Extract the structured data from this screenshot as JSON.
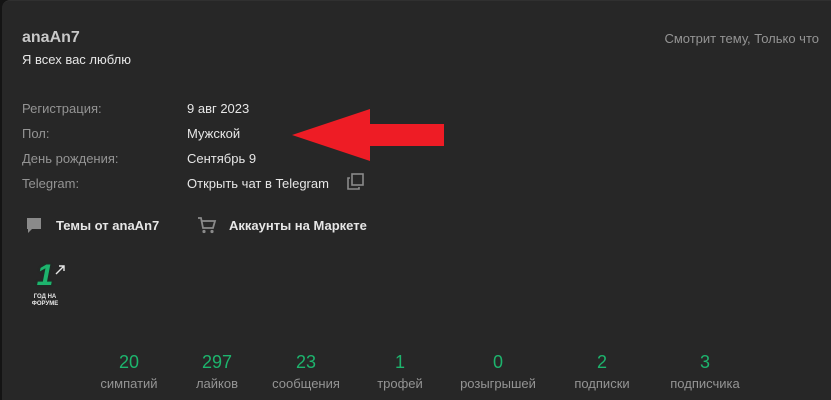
{
  "profile": {
    "username": "anaAn7",
    "status": "Я всех вас люблю",
    "activity": "Смотрит тему, Только что"
  },
  "info": {
    "registration_label": "Регистрация:",
    "registration_value": "9 авг 2023",
    "gender_label": "Пол:",
    "gender_value": "Мужской",
    "birthday_label": "День рождения:",
    "birthday_value": "Сентябрь 9",
    "telegram_label": "Telegram:",
    "telegram_value": "Открыть чат в Telegram"
  },
  "links": {
    "topics": "Темы от anaAn7",
    "market": "Аккаунты на Маркете"
  },
  "badge": {
    "number": "1",
    "line1": "ГОД НА",
    "line2": "ФОРУМЕ"
  },
  "stats": [
    {
      "value": "20",
      "label": "симпатий"
    },
    {
      "value": "297",
      "label": "лайков"
    },
    {
      "value": "23",
      "label": "сообщения"
    },
    {
      "value": "1",
      "label": "трофей"
    },
    {
      "value": "0",
      "label": "розыгрышей"
    },
    {
      "value": "2",
      "label": "подписки"
    },
    {
      "value": "3",
      "label": "подписчика"
    }
  ],
  "colors": {
    "background": "#272727",
    "accent_green": "#1db46d",
    "annotation_arrow": "#ee1c25",
    "muted_text": "#949494",
    "primary_text": "#e6e6e6"
  },
  "icons": {
    "topics": "speech-bubble-icon",
    "market": "shopping-cart-icon",
    "telegram_copy": "copy-icon",
    "annotation": "red-arrow"
  }
}
